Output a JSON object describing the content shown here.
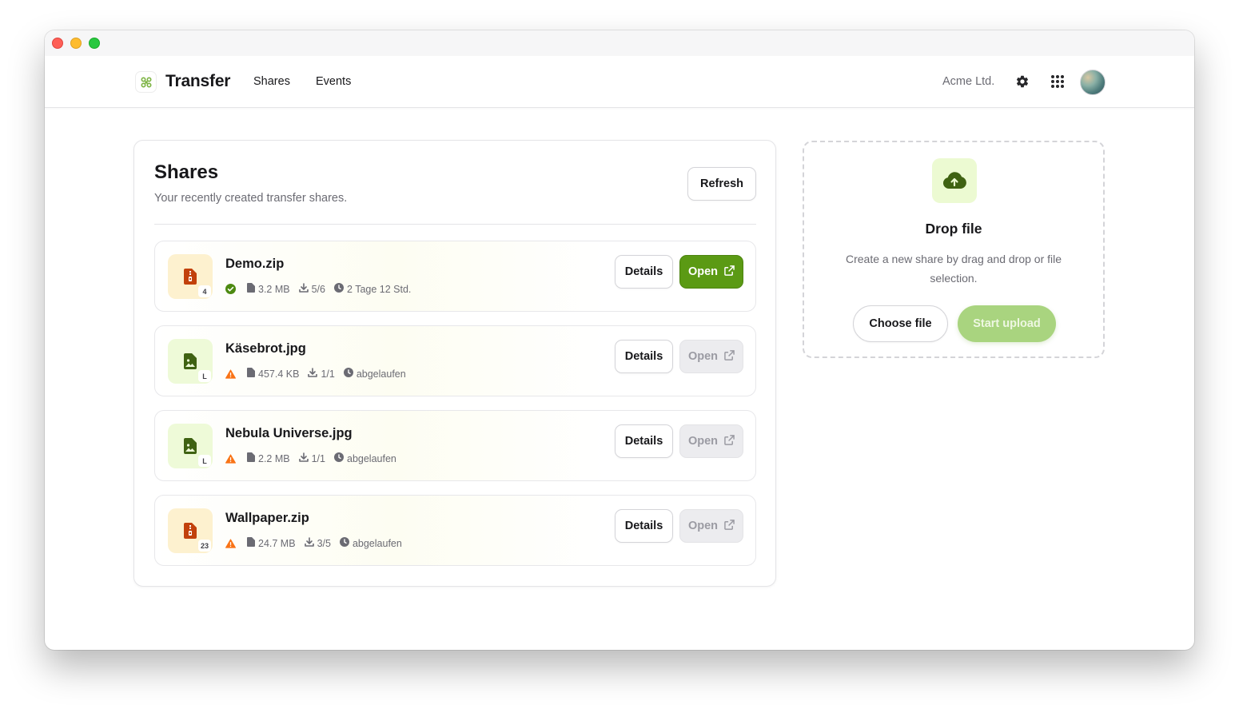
{
  "app": {
    "brand": "Transfer",
    "org": "Acme Ltd."
  },
  "nav": {
    "shares": "Shares",
    "events": "Events"
  },
  "shares_card": {
    "title": "Shares",
    "subtitle": "Your recently created transfer shares.",
    "refresh_label": "Refresh"
  },
  "shares": [
    {
      "name": "Demo.zip",
      "type": "zip",
      "badge": "4",
      "status": "ok",
      "size": "3.2 MB",
      "downloads": "5/6",
      "expiry": "2 Tage 12 Std.",
      "details_label": "Details",
      "open_label": "Open",
      "open_enabled": true
    },
    {
      "name": "Käsebrot.jpg",
      "type": "image",
      "badge": "L",
      "status": "warning",
      "size": "457.4 KB",
      "downloads": "1/1",
      "expiry": "abgelaufen",
      "details_label": "Details",
      "open_label": "Open",
      "open_enabled": false
    },
    {
      "name": "Nebula Universe.jpg",
      "type": "image",
      "badge": "L",
      "status": "warning",
      "size": "2.2 MB",
      "downloads": "1/1",
      "expiry": "abgelaufen",
      "details_label": "Details",
      "open_label": "Open",
      "open_enabled": false
    },
    {
      "name": "Wallpaper.zip",
      "type": "zip",
      "badge": "23",
      "status": "warning",
      "size": "24.7 MB",
      "downloads": "3/5",
      "expiry": "abgelaufen",
      "details_label": "Details",
      "open_label": "Open",
      "open_enabled": false
    }
  ],
  "drop": {
    "title": "Drop file",
    "description": "Create a new share by drag and drop or file selection.",
    "choose_label": "Choose file",
    "upload_label": "Start upload"
  },
  "colors": {
    "accent": "#5b9a14",
    "accent_light": "#a9d47f",
    "warning": "#f97316",
    "success": "#4d8a12"
  },
  "icons": [
    "logo-icon",
    "gear-icon",
    "apps-grid-icon",
    "zip-file-icon",
    "image-file-icon",
    "check-circle-icon",
    "warning-icon",
    "file-size-icon",
    "download-icon",
    "clock-icon",
    "external-link-icon",
    "cloud-upload-icon"
  ]
}
